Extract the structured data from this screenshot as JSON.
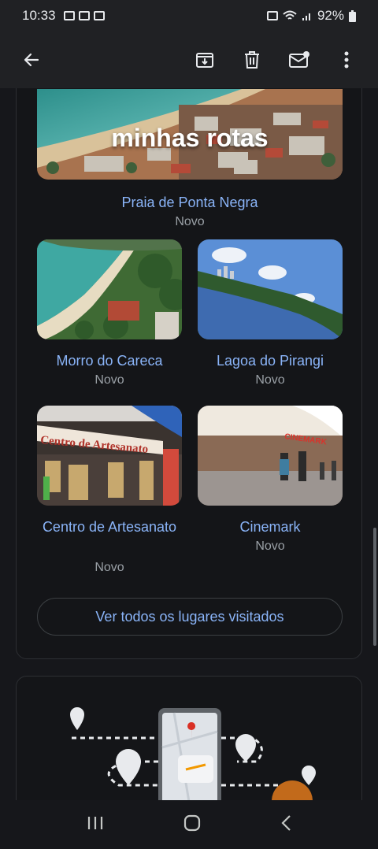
{
  "status": {
    "time": "10:33",
    "battery": "92%"
  },
  "icons": {
    "back": "arrow-left-icon",
    "archive": "archive-icon",
    "delete": "trash-icon",
    "mark_unread": "mail-unread-icon",
    "more": "more-vert-icon"
  },
  "hero": {
    "overlay_text": "minhas rotas",
    "title": "Praia de Ponta Negra",
    "status": "Novo"
  },
  "places": [
    {
      "title": "Morro do Careca",
      "status": "Novo"
    },
    {
      "title": "Lagoa do Pirangi",
      "status": "Novo"
    },
    {
      "title": "Centro de Artesanato",
      "status": "Novo"
    },
    {
      "title": "Cinemark",
      "status": "Novo"
    }
  ],
  "thumb_text": {
    "shop_sign": "Centro de Artesanato",
    "cinema_sign": "CINEMARK"
  },
  "visit_button": "Ver todos os lugares visitados",
  "colors": {
    "link": "#8ab4f8",
    "muted": "#9aa0a6",
    "bar": "#202124",
    "background": "#16171b"
  }
}
